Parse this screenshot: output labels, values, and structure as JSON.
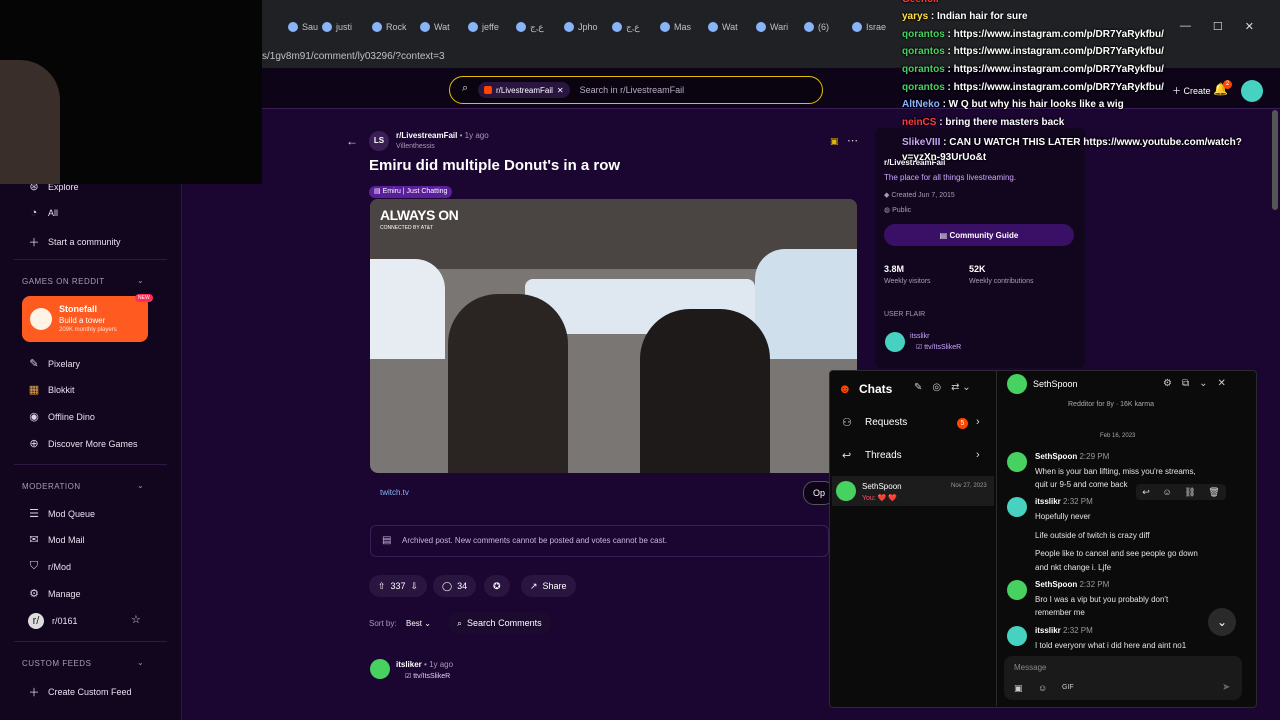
{
  "browser": {
    "tabs": [
      "Sau",
      "justi",
      "Rock",
      "Wat",
      "jeffe",
      "ع,ج",
      "Jpho",
      "ع,ج",
      "Mas",
      "Wat",
      "Wari",
      "(6)",
      "Israe"
    ],
    "url": "s/1gv8m91/comment/ly03296/?context=3"
  },
  "header": {
    "search_chip": "r/LivestreamFail",
    "search_placeholder": "Search in r/LivestreamFail",
    "create_label": "Create",
    "notif_count": "2"
  },
  "sidebar": {
    "explore": "Explore",
    "all": "All",
    "start_community": "Start a community",
    "games_section": "GAMES ON REDDIT",
    "stonefall_title": "Stonefall",
    "stonefall_sub": "Build a tower",
    "stonefall_players": "209K monthly players",
    "new_badge": "NEW",
    "games": [
      "Pixelary",
      "Blokkit",
      "Offline Dino",
      "Discover More Games"
    ],
    "moderation_section": "MODERATION",
    "mod_items": [
      "Mod Queue",
      "Mod Mail",
      "r/Mod",
      "Manage",
      "r/0161"
    ],
    "custom_section": "CUSTOM FEEDS",
    "create_custom": "Create Custom Feed"
  },
  "post": {
    "subreddit": "r/LivestreamFail",
    "age": "1y ago",
    "author": "Villenthessis",
    "title": "Emiru did multiple Donut's in a row",
    "flair": "Emiru | Just Chatting",
    "video_logo": "ALWAYS ON",
    "video_logo_sub": "CONNECTED BY AT&T",
    "link": "twitch.tv",
    "open_label": "Op",
    "archived_notice": "Archived post. New comments cannot be posted and votes cannot be cast.",
    "upvotes": "337",
    "comments": "34",
    "share": "Share",
    "sort_label": "Sort by:",
    "sort_value": "Best",
    "search_comments": "Search Comments",
    "comment_author": "itsliker",
    "comment_age": "1y ago",
    "comment_flair": "ttv/ItsSlikeR"
  },
  "community": {
    "name": "r/LivestreamFail",
    "description": "The place for all things livestreaming.",
    "created": "Created Jun 7, 2015",
    "visibility": "Public",
    "guide": "Community Guide",
    "visitors": "3.8M",
    "visitors_label": "Weekly visitors",
    "contributions": "52K",
    "contributions_label": "Weekly contributions",
    "user_flair": "USER FLAIR",
    "flair_user": "itsslikr",
    "flair_text": "ttv/ItsSlikeR"
  },
  "stream_chat": [
    {
      "user": "Geeholl",
      "text": "",
      "color": "#ff3b3b"
    },
    {
      "user": "yarys",
      "text": ": Indian hair for sure",
      "color": "#ffe14d"
    },
    {
      "user": "qorantos",
      "text": ": https://www.instagram.com/p/DR7YaRykfbu/",
      "color": "#46d160"
    },
    {
      "user": "qorantos",
      "text": ": https://www.instagram.com/p/DR7YaRykfbu/",
      "color": "#46d160"
    },
    {
      "user": "qorantos",
      "text": ": https://www.instagram.com/p/DR7YaRykfbu/",
      "color": "#46d160"
    },
    {
      "user": "qorantos",
      "text": ": https://www.instagram.com/p/DR7YaRykfbu/",
      "color": "#46d160"
    },
    {
      "user": "AltNeko",
      "text": ": W Q but why his hair looks like a wig",
      "color": "#8ab4f8"
    },
    {
      "user": "neinCS",
      "text": ": bring there masters back",
      "color": "#ff3b3b"
    },
    {
      "user": "SlikeVIII",
      "text": ": CAN U WATCH THIS LATER https://www.youtube.com/watch?v=yzXn-93UrUo&t",
      "color": "#c9a6ff"
    }
  ],
  "chats": {
    "title": "Chats",
    "requests": "Requests",
    "requests_count": "5",
    "threads": "Threads",
    "conv_name": "SethSpoon",
    "conv_preview": "You: ❤️ ❤️",
    "conv_date": "Nov 27, 2023",
    "open_name": "SethSpoon",
    "profile_meta": "Redditor for 8y · 16K karma",
    "date_divider": "Feb 16, 2023",
    "messages": [
      {
        "user": "SethSpoon",
        "time": "2:29 PM",
        "lines": [
          "When is your ban lifting, miss you're streams,",
          "quit ur 9-5 and come back"
        ]
      },
      {
        "user": "itsslikr",
        "time": "2:32 PM",
        "lines": [
          "Hopefully never",
          "",
          "Life outside of twitch is crazy diff",
          "",
          "People like to cancel and see people go down",
          "and nkt change i. Ljfe"
        ]
      },
      {
        "user": "SethSpoon",
        "time": "2:32 PM",
        "lines": [
          "Bro I was a vip but you probably don't",
          "remember me"
        ]
      },
      {
        "user": "itsslikr",
        "time": "2:32 PM",
        "lines": [
          "I told everyonr what i did here and aint no1"
        ]
      }
    ],
    "message_placeholder": "Message",
    "gif_label": "GIF"
  }
}
